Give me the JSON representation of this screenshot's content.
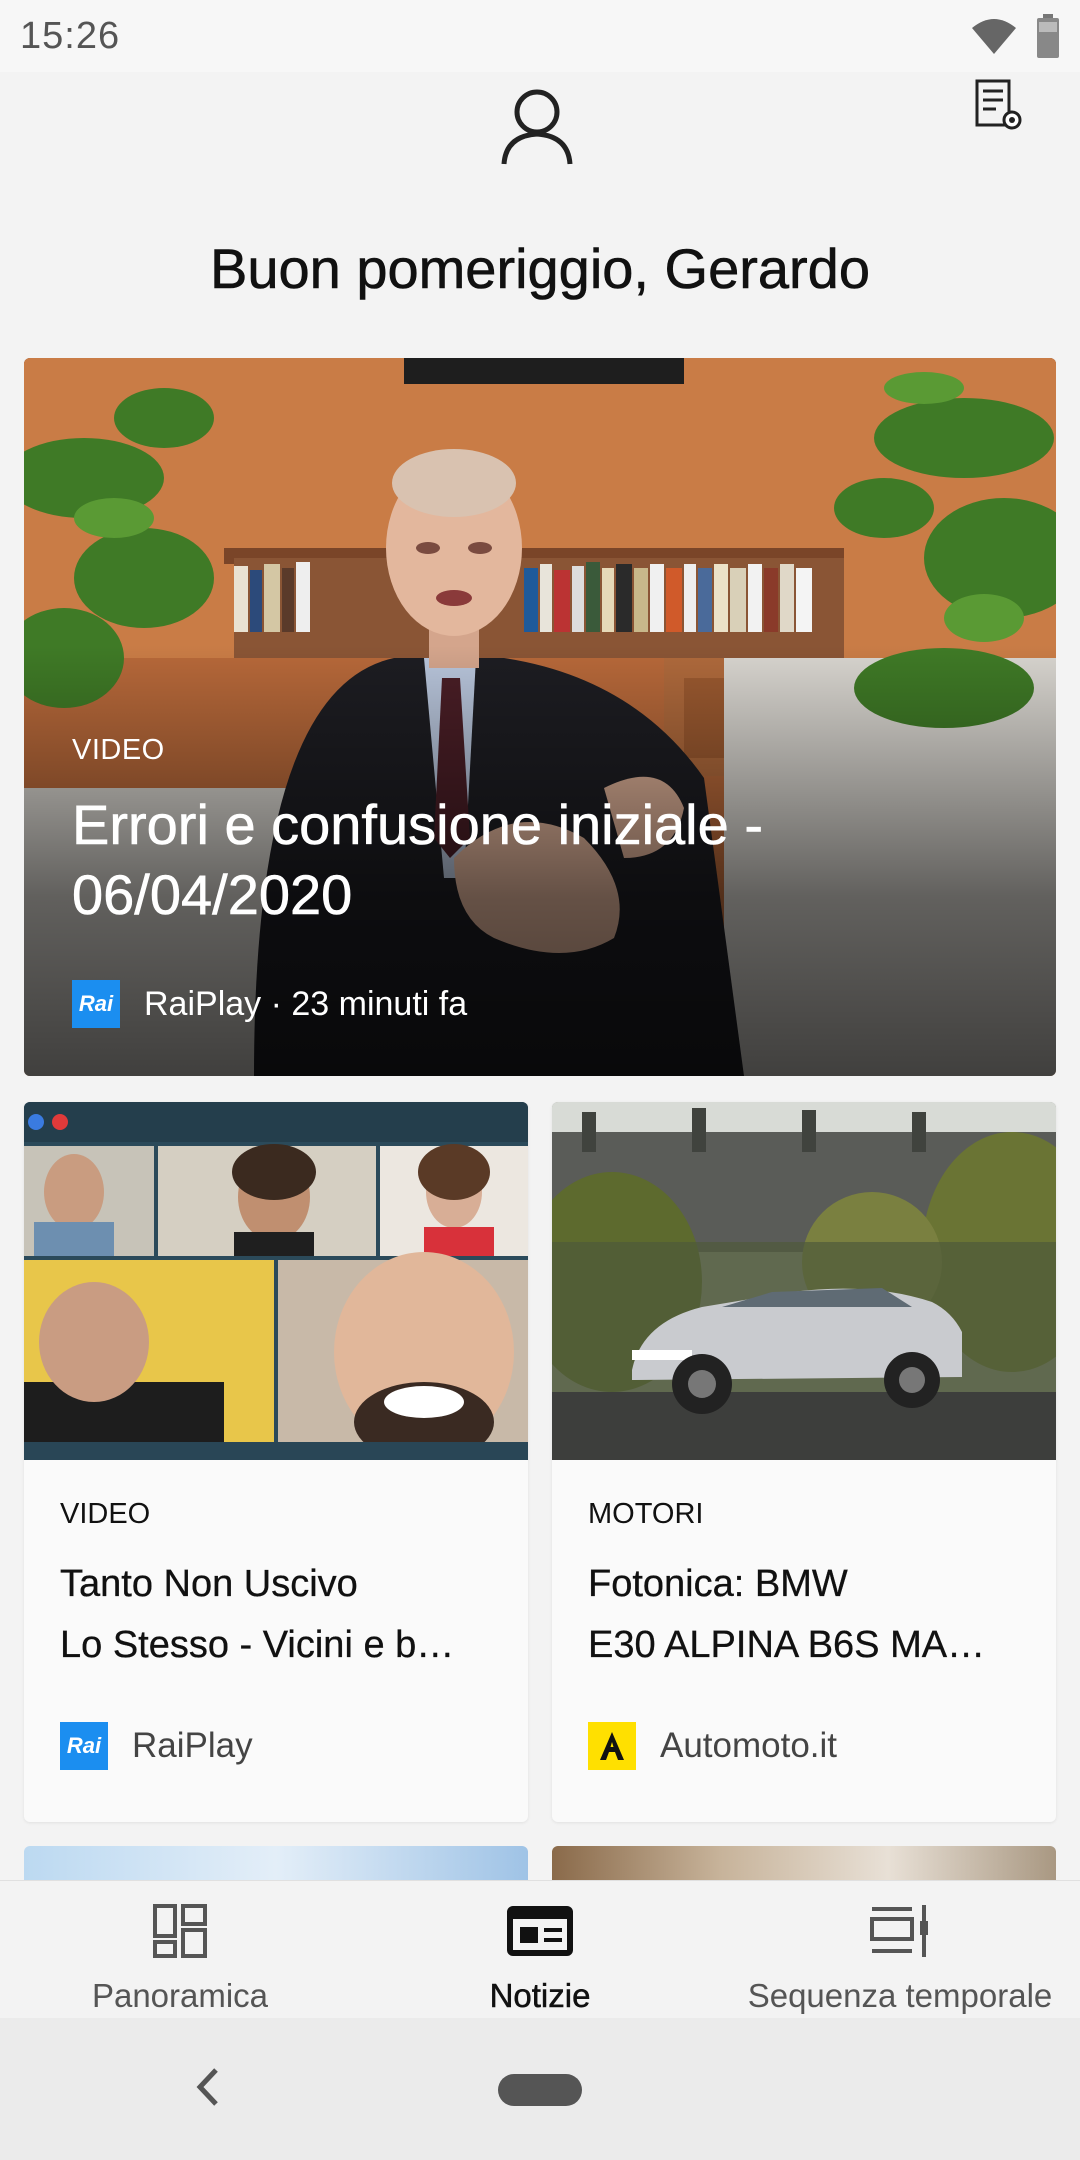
{
  "status_bar": {
    "time": "15:26"
  },
  "header": {
    "profile_icon": "person-outline-icon",
    "settings_icon": "feed-settings-icon"
  },
  "greeting": "Buon pomeriggio, Gerardo",
  "hero": {
    "category": "VIDEO",
    "title": "Errori e confusione iniziale - 06/04/2020",
    "source_logo": "Rai",
    "source": "RaiPlay · 23 minuti fa"
  },
  "cards": [
    {
      "category": "VIDEO",
      "title_line1": "Tanto Non Uscivo",
      "title_line2": "Lo Stesso - Vicini e b…",
      "source_logo": "Rai",
      "source": "RaiPlay"
    },
    {
      "category": "MOTORI",
      "title_line1": "Fotonica: BMW",
      "title_line2": "E30 ALPINA B6S MA…",
      "source_logo": "A",
      "source": "Automoto.it"
    }
  ],
  "tabs": [
    {
      "label": "Panoramica",
      "icon": "dashboard-icon",
      "active": false
    },
    {
      "label": "Notizie",
      "icon": "news-icon",
      "active": true
    },
    {
      "label": "Sequenza temporale",
      "icon": "timeline-icon",
      "active": false
    }
  ],
  "colors": {
    "rai_blue": "#1b8ef0",
    "automoto_yellow": "#ffe000",
    "background": "#f3f3f3"
  }
}
